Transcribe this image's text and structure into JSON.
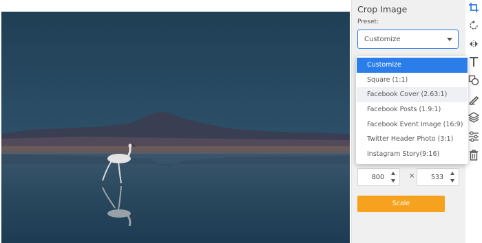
{
  "panel": {
    "title": "Crop Image",
    "preset_label": "Preset:",
    "preset_value": "Customize"
  },
  "dropdown": {
    "options": [
      "Customize",
      "Square (1:1)",
      "Facebook Cover (2.63:1)",
      "Facebook Posts (1.9:1)",
      "Facebook Event Image (16:9)",
      "Twitter Header Photo (3:1)",
      "Instagram Story(9:16)"
    ],
    "selected_index": 0,
    "hover_index": 2
  },
  "size": {
    "width": "800",
    "height": "533",
    "separator": "×"
  },
  "actions": {
    "scale_label": "Scale"
  },
  "toolbar": {
    "icons": [
      "crop-icon",
      "rotate-icon",
      "flip-icon",
      "text-icon",
      "shapes-icon",
      "draw-icon",
      "layers-icon",
      "adjust-icon",
      "trash-icon"
    ]
  },
  "colors": {
    "accent": "#2b7de9",
    "scale_button": "#f6a21e",
    "panel_bg": "#f0f0f0",
    "active_tool": "#2b7de9"
  }
}
